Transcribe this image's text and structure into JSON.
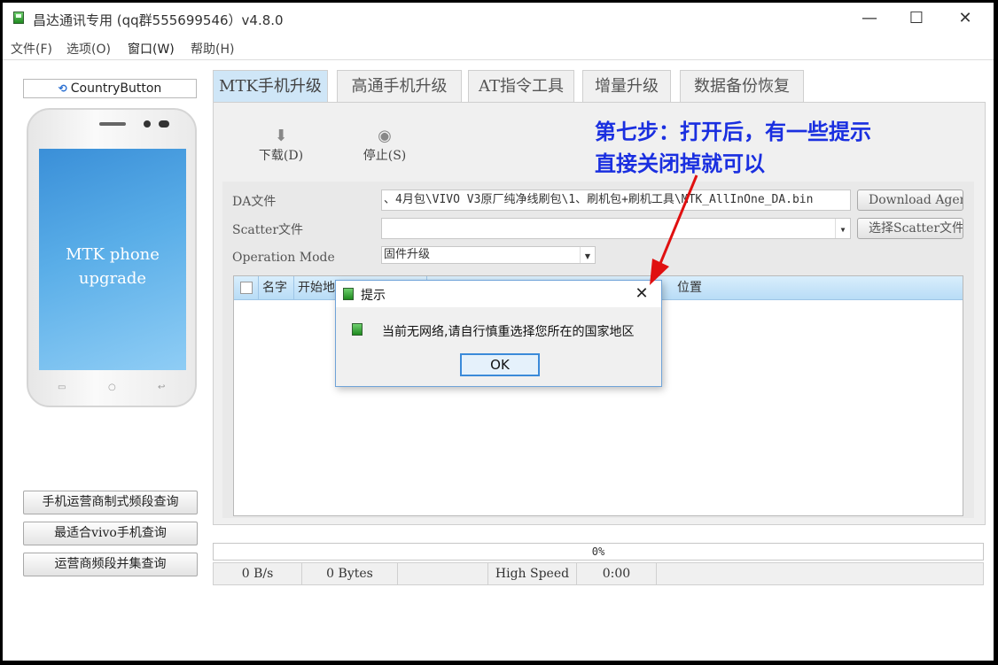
{
  "window": {
    "title": "昌达通讯专用   (qq群555699546）v4.8.0",
    "controls": {
      "minimize": "—",
      "maximize": "☐",
      "close": "✕"
    }
  },
  "menu": [
    "文件(F)",
    "选项(O)",
    "窗口(W)",
    "帮助(H)"
  ],
  "left": {
    "country_button": "CountryButton",
    "phone_screen_text": "MTK phone\nupgrade",
    "buttons": [
      "手机运营商制式频段查询",
      "最适合vivo手机查询",
      "运营商频段并集查询"
    ]
  },
  "tabs": [
    "MTK手机升级",
    "高通手机升级",
    "AT指令工具",
    "增量升级",
    "数据备份恢复"
  ],
  "toolbar": {
    "download": "下载(D)",
    "stop": "停止(S)"
  },
  "form": {
    "da_label": "DA文件",
    "da_value": "、4月包\\VIVO V3原厂纯净线刷包\\1、刷机包+刷机工具\\MTK_AllInOne_DA.bin",
    "da_button": "Download Agent",
    "scatter_label": "Scatter文件",
    "scatter_value": "",
    "scatter_button": "选择Scatter文件",
    "mode_label": "Operation Mode",
    "mode_value": "固件升级"
  },
  "table": {
    "columns": [
      "名字",
      "开始地",
      "位置"
    ]
  },
  "progress": "0%",
  "status": [
    "0 B/s",
    "0 Bytes",
    "",
    "High Speed",
    "0:00"
  ],
  "dialog": {
    "title": "提示",
    "close": "✕",
    "message": "当前无网络,请自行慎重选择您所在的国家地区",
    "ok": "OK"
  },
  "annotation": "第七步：打开后，有一些提示\n直接关闭掉就可以",
  "colors": {
    "annotation": "#1a2fe0",
    "arrow": "#e01010",
    "tab_active": "#cfe6f7"
  }
}
